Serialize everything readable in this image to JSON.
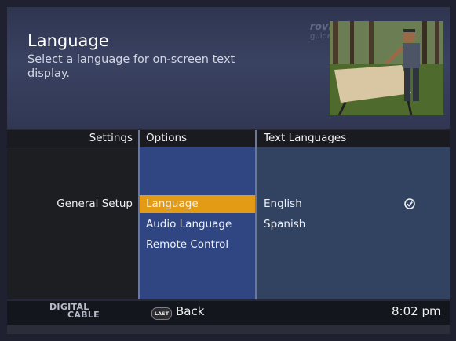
{
  "header": {
    "title": "Language",
    "subtitle": "Select a language for on-screen text display.",
    "brand": {
      "line1": "rovi",
      "line2": "guide"
    }
  },
  "preview": {
    "description_icon": "live-tv-preview-icon"
  },
  "columns": {
    "settings": {
      "label": "Settings",
      "items": [
        "General Setup"
      ]
    },
    "options": {
      "label": "Options",
      "items": [
        "Language",
        "Audio Language",
        "Remote Control"
      ],
      "selected_index": 0
    },
    "values": {
      "label": "Text Languages",
      "items": [
        "English",
        "Spanish"
      ],
      "checked_index": 0
    }
  },
  "footer": {
    "logo_line1": "DIGITAL",
    "logo_line2": "CABLE",
    "last_button": "LAST",
    "back_label": "Back",
    "time": "8:02 pm"
  },
  "colors": {
    "highlight": "#e39a14",
    "options_bg": "#2f4682",
    "values_bg": "#324361",
    "header_bg": "#3a4262"
  }
}
